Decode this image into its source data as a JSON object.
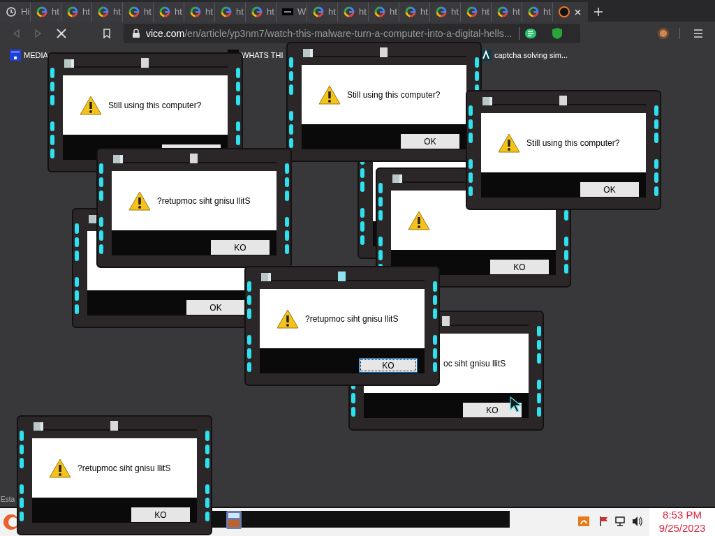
{
  "tabs": [
    {
      "kind": "history",
      "label": "Hi",
      "selected": false
    },
    {
      "kind": "google",
      "label": "ht",
      "selected": false
    },
    {
      "kind": "google",
      "label": "ht",
      "selected": false
    },
    {
      "kind": "google",
      "label": "ht",
      "selected": false
    },
    {
      "kind": "google",
      "label": "ht",
      "selected": false
    },
    {
      "kind": "google",
      "label": "ht",
      "selected": false
    },
    {
      "kind": "google",
      "label": "ht",
      "selected": false
    },
    {
      "kind": "google",
      "label": "ht",
      "selected": false
    },
    {
      "kind": "google",
      "label": "ht",
      "selected": false
    },
    {
      "kind": "dark",
      "label": "W",
      "selected": false
    },
    {
      "kind": "google",
      "label": "ht",
      "selected": false
    },
    {
      "kind": "google",
      "label": "ht",
      "selected": false
    },
    {
      "kind": "google",
      "label": "ht",
      "selected": false
    },
    {
      "kind": "google",
      "label": "ht",
      "selected": false
    },
    {
      "kind": "google",
      "label": "ht",
      "selected": false
    },
    {
      "kind": "google",
      "label": "ht",
      "selected": false
    },
    {
      "kind": "google",
      "label": "ht",
      "selected": false
    },
    {
      "kind": "google",
      "label": "ht",
      "selected": false
    },
    {
      "kind": "active",
      "selected": true
    }
  ],
  "address_bar": {
    "host": "vice.com",
    "path": "/en/article/yp3nm7/watch-this-malware-turn-a-computer-into-a-digital-hells..."
  },
  "bookmarks": [
    {
      "kind": "blue",
      "label": "MEDIA"
    },
    {
      "kind": "dark",
      "label": "WHATS THI"
    },
    {
      "kind": "teal",
      "label": "captcha solving sim..."
    }
  ],
  "dialogs": [
    {
      "button": "KO",
      "focused": false
    },
    {
      "focused": false,
      "message": "Still using this computer?"
    },
    {
      "button": "OK",
      "focused": false,
      "message": "Still using this computer?"
    },
    {
      "button": "OK",
      "focused": false,
      "message": "Still using this computer?"
    },
    {
      "button": "OK",
      "focused": false
    },
    {
      "button": "KO",
      "focused": false,
      "message": "?retupmoc siht gnisu llitS"
    },
    {
      "button": "KO",
      "focused": false,
      "message": "oc siht gnisu llitS"
    },
    {
      "button": "KO",
      "focused": true,
      "message": "?retupmoc siht gnisu llitS"
    },
    {
      "button": "KO",
      "focused": false,
      "message": "?retupmoc siht gnisu llitS"
    }
  ],
  "status_text": "Esta",
  "clock": {
    "time": "8:53 PM",
    "date": "9/25/2023"
  }
}
